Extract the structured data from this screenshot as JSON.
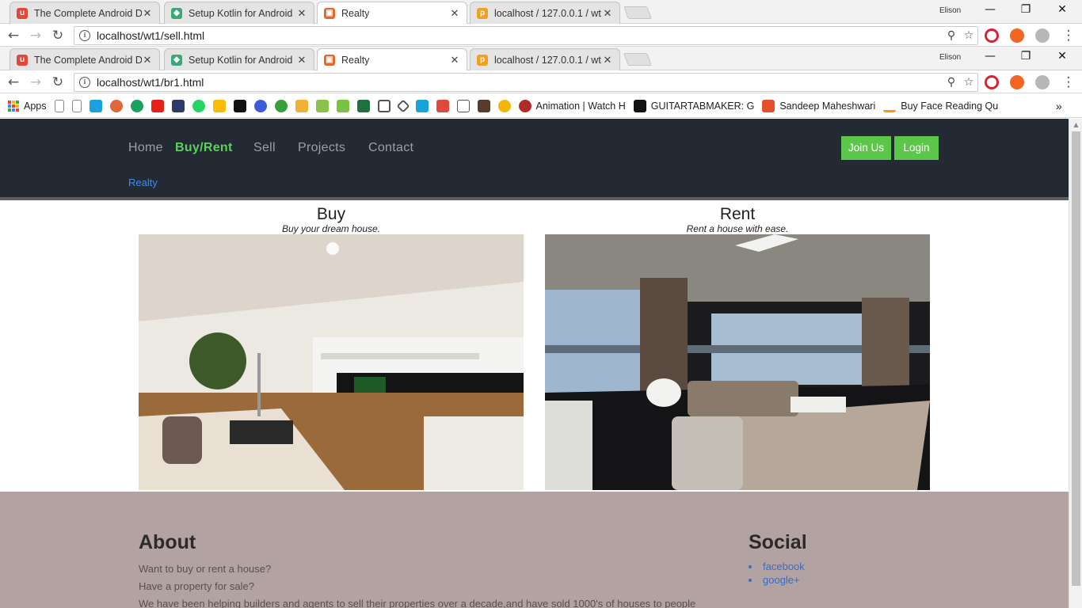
{
  "window_back": {
    "tabs": [
      {
        "title": "The Complete Android D",
        "favicon_color": "#e0483a"
      },
      {
        "title": "Setup Kotlin for Android",
        "favicon_color": "#3aa876"
      },
      {
        "title": "Realty",
        "favicon_color": "#e4682a"
      },
      {
        "title": "localhost / 127.0.0.1 / wt",
        "favicon_color": "#f0a020"
      }
    ],
    "url": "localhost/wt1/sell.html"
  },
  "window_front": {
    "tabs": [
      {
        "title": "The Complete Android D",
        "favicon_color": "#e0483a"
      },
      {
        "title": "Setup Kotlin for Android",
        "favicon_color": "#3aa876"
      },
      {
        "title": "Realty",
        "favicon_color": "#e4682a"
      },
      {
        "title": "localhost / 127.0.0.1 / wt",
        "favicon_color": "#f0a020"
      }
    ],
    "url": "localhost/wt1/br1.html"
  },
  "profile_name": "Elison",
  "bookmarks": {
    "apps_label": "Apps",
    "items": [
      {
        "label": "Animation | Watch H"
      },
      {
        "label": "GUITARTABMAKER: G"
      },
      {
        "label": "Sandeep Maheshwari"
      },
      {
        "label": "Buy Face Reading Qu"
      }
    ],
    "overflow": "»"
  },
  "site": {
    "nav": {
      "home": "Home",
      "buy_rent": "Buy/Rent",
      "sell": "Sell",
      "projects": "Projects",
      "contact": "Contact",
      "join_us": "Join Us",
      "login": "Login",
      "brand": "Realty"
    },
    "buy": {
      "title": "Buy",
      "subtitle": "Buy your dream house."
    },
    "rent": {
      "title": "Rent",
      "subtitle": "Rent a house with ease."
    },
    "footer": {
      "about_title": "About",
      "about_lines": [
        "Want to buy or rent a house?",
        "Have a property for sale?",
        "We have been helping builders and agents to sell their properties over a decade,and have sold 1000's of houses to people"
      ],
      "social_title": "Social",
      "social_links": [
        "facebook",
        "google+"
      ]
    },
    "colors": {
      "nav_bg": "#232a33",
      "accent_green": "#5bc64a",
      "brand_blue": "#3e8ee8",
      "footer_bg": "#b2a2a2"
    }
  }
}
